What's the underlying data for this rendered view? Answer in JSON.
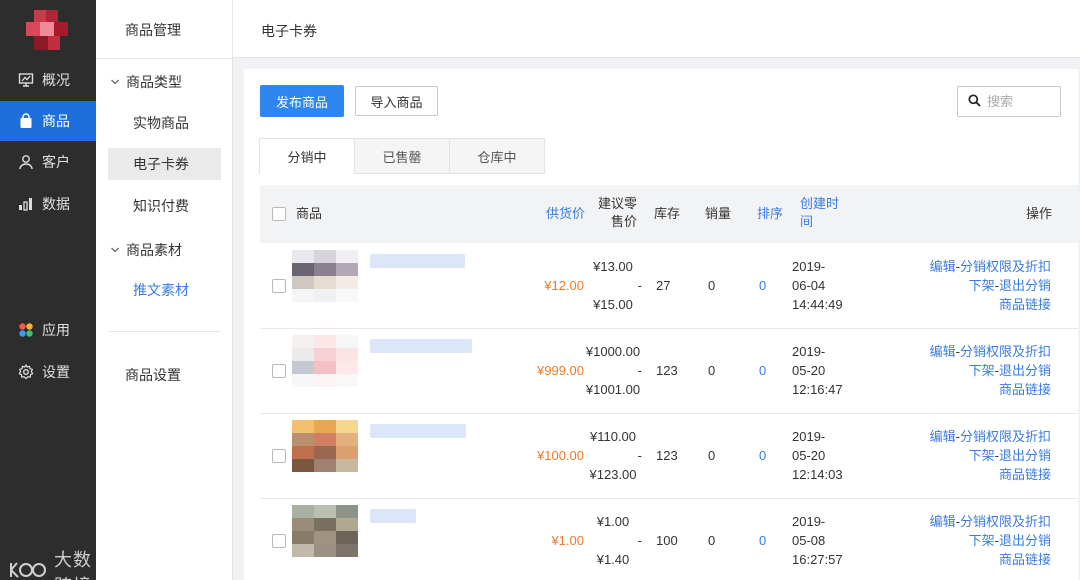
{
  "nav": {
    "items": [
      {
        "label": "概况",
        "icon": "dashboard-icon"
      },
      {
        "label": "商品",
        "icon": "shopping-bag-icon"
      },
      {
        "label": "客户",
        "icon": "user-icon"
      },
      {
        "label": "数据",
        "icon": "bar-chart-icon"
      },
      {
        "label": "应用",
        "icon": "apps-icon"
      },
      {
        "label": "设置",
        "icon": "gear-icon"
      }
    ],
    "active": "商品"
  },
  "watermark": "大数跨境",
  "sub": {
    "title": "商品管理",
    "group1": "商品类型",
    "group1_items": [
      "实物商品",
      "电子卡券",
      "知识付费"
    ],
    "group2": "商品素材",
    "group2_items": [
      "推文素材"
    ],
    "settings": "商品设置"
  },
  "header": {
    "title": "电子卡券"
  },
  "toolbar": {
    "publish": "发布商品",
    "import": "导入商品",
    "search_placeholder": "搜索"
  },
  "tabs": [
    "分销中",
    "已售罄",
    "仓库中"
  ],
  "table": {
    "headers": {
      "product": "商品",
      "supply_price": "供货价",
      "retail_l1": "建议零",
      "retail_l2": "售价",
      "stock": "库存",
      "sales": "销量",
      "sort": "排序",
      "created_l1": "创建时",
      "created_l2": "间",
      "ops": "操作"
    },
    "rows": [
      {
        "supply": "¥12.00",
        "retail_min": "¥13.00",
        "dash": "-",
        "retail_max": "¥15.00",
        "stock": "27",
        "sales": "0",
        "sort": "0",
        "date1": "2019-",
        "date2": "06-04",
        "time": "14:44:49"
      },
      {
        "supply": "¥999.00",
        "retail_min": "¥1000.00",
        "dash": "-",
        "retail_max": "¥1001.00",
        "stock": "123",
        "sales": "0",
        "sort": "0",
        "date1": "2019-",
        "date2": "05-20",
        "time": "12:16:47"
      },
      {
        "supply": "¥100.00",
        "retail_min": "¥110.00",
        "dash": "-",
        "retail_max": "¥123.00",
        "stock": "123",
        "sales": "0",
        "sort": "0",
        "date1": "2019-",
        "date2": "05-20",
        "time": "12:14:03"
      },
      {
        "supply": "¥1.00",
        "retail_min": "¥1.00",
        "dash": "-",
        "retail_max": "¥1.40",
        "stock": "100",
        "sales": "0",
        "sort": "0",
        "date1": "2019-",
        "date2": "05-08",
        "time": "16:27:57"
      }
    ],
    "ops": {
      "edit": "编辑",
      "perm": "分销权限及折扣",
      "off": "下架",
      "exit": "退出分销",
      "link": "商品链接",
      "sep": "-"
    }
  },
  "colors": {
    "primary": "#2e86f0",
    "nav_bg": "#2d2d2d",
    "active_nav": "#1e6fd9",
    "price": "#f07a27",
    "link": "#3a7be0"
  }
}
